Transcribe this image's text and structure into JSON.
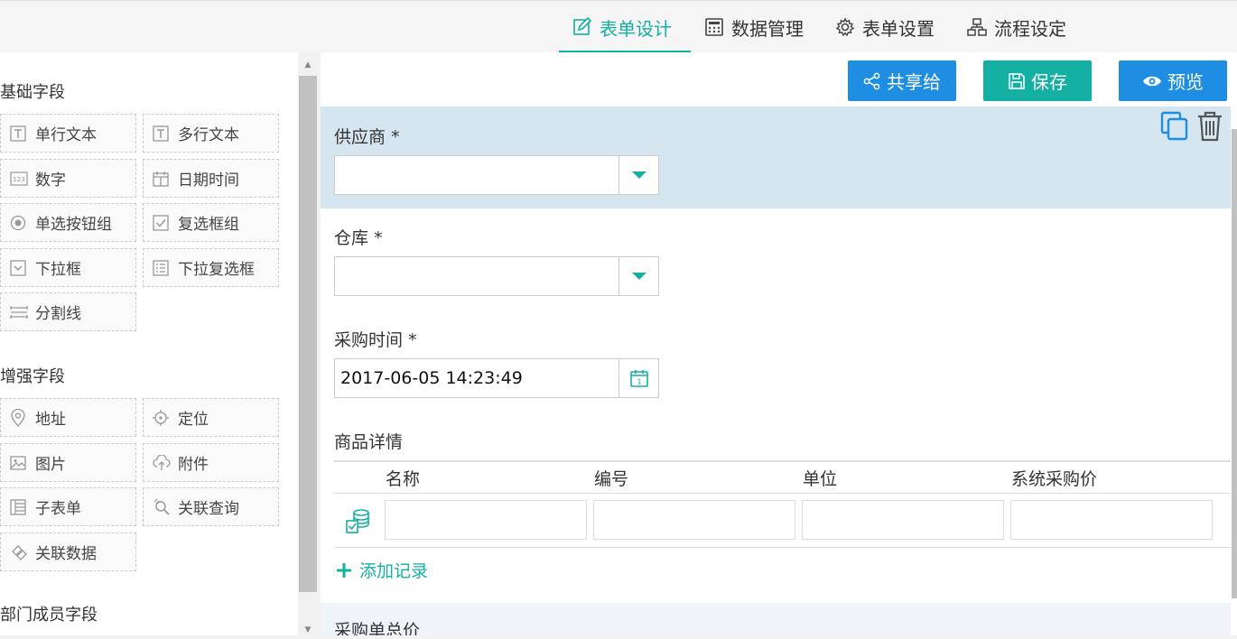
{
  "nav": {
    "tabs": [
      {
        "label": "表单设计",
        "icon": "edit-icon",
        "active": true
      },
      {
        "label": "数据管理",
        "icon": "calculator-icon",
        "active": false
      },
      {
        "label": "表单设置",
        "icon": "gear-icon",
        "active": false
      },
      {
        "label": "流程设定",
        "icon": "flowchart-icon",
        "active": false
      }
    ]
  },
  "sidebar": {
    "groups": [
      {
        "title": "基础字段",
        "items": [
          {
            "label": "单行文本",
            "icon": "text-t-icon"
          },
          {
            "label": "多行文本",
            "icon": "text-t-icon"
          },
          {
            "label": "数字",
            "icon": "number-123-icon"
          },
          {
            "label": "日期时间",
            "icon": "calendar-icon"
          },
          {
            "label": "单选按钮组",
            "icon": "radio-icon"
          },
          {
            "label": "复选框组",
            "icon": "checkbox-icon"
          },
          {
            "label": "下拉框",
            "icon": "dropdown-icon"
          },
          {
            "label": "下拉复选框",
            "icon": "checklist-icon"
          },
          {
            "label": "分割线",
            "icon": "divider-icon"
          }
        ]
      },
      {
        "title": "增强字段",
        "items": [
          {
            "label": "地址",
            "icon": "map-pin-icon"
          },
          {
            "label": "定位",
            "icon": "crosshair-icon"
          },
          {
            "label": "图片",
            "icon": "image-icon"
          },
          {
            "label": "附件",
            "icon": "upload-cloud-icon"
          },
          {
            "label": "子表单",
            "icon": "subform-icon"
          },
          {
            "label": "关联查询",
            "icon": "link-search-icon"
          },
          {
            "label": "关联数据",
            "icon": "link-data-icon"
          }
        ]
      },
      {
        "title": "部门成员字段",
        "items": []
      }
    ]
  },
  "toolbar": {
    "share_label": "共享给",
    "save_label": "保存",
    "preview_label": "预览",
    "share_color": "#1e8ee2",
    "save_color": "#14b0a3",
    "preview_color": "#1e8ee2"
  },
  "form": {
    "supplier": {
      "label": "供应商",
      "required": "*",
      "value": ""
    },
    "warehouse": {
      "label": "仓库",
      "required": "*",
      "value": ""
    },
    "purchase_time": {
      "label": "采购时间",
      "required": "*",
      "value": "2017-06-05 14:23:49"
    },
    "items": {
      "label": "商品详情",
      "columns": [
        "名称",
        "编号",
        "单位",
        "系统采购价"
      ],
      "add_label": "添加记录"
    },
    "total": {
      "label": "采购单总价"
    }
  },
  "colors": {
    "accent": "#14b0a3",
    "selected_row": "#d6e6f1"
  }
}
